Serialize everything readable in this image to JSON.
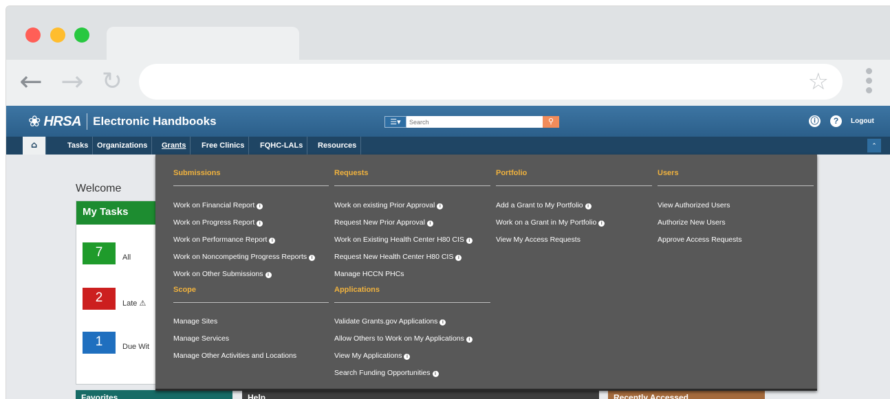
{
  "header": {
    "brand": "HRSA",
    "app_title": "Electronic Handbooks",
    "search_placeholder": "Search",
    "logout_label": "Logout"
  },
  "nav": {
    "items": [
      "Tasks",
      "Organizations",
      "Grants",
      "Free Clinics",
      "FQHC-LALs",
      "Resources"
    ],
    "active": "Grants"
  },
  "page": {
    "welcome": "Welcome",
    "my_tasks_title": "My Tasks",
    "tasks": [
      {
        "count": "7",
        "label": "All",
        "color": "#1f9b2b"
      },
      {
        "count": "2",
        "label": "Late",
        "color": "#cc1f1f"
      },
      {
        "count": "1",
        "label": "Due Wit",
        "color": "#1f6fbf"
      }
    ],
    "bottom_panels": [
      "Favorites",
      "Help",
      "Recently Accessed"
    ]
  },
  "mega_menu": {
    "submissions": {
      "heading": "Submissions",
      "links": [
        "Work on Financial Report",
        "Work on Progress Report",
        "Work on Performance Report",
        "Work on Noncompeting Progress Reports",
        "Work on Other Submissions"
      ]
    },
    "scope": {
      "heading": "Scope",
      "links": [
        "Manage Sites",
        "Manage Services",
        "Manage Other Activities and Locations"
      ]
    },
    "requests": {
      "heading": "Requests",
      "links": [
        "Work on existing Prior Approval",
        "Request New Prior Approval",
        "Work on Existing Health Center H80 CIS",
        "Request New Health Center H80 CIS",
        "Manage HCCN PHCs"
      ]
    },
    "applications": {
      "heading": "Applications",
      "links": [
        "Validate Grants.gov Applications",
        "Allow Others to Work on My Applications",
        "View My Applications",
        "Search Funding Opportunities"
      ]
    },
    "portfolio": {
      "heading": "Portfolio",
      "links": [
        "Add a Grant to My Portfolio",
        "Work on a Grant in My Portfolio",
        "View My Access Requests"
      ]
    },
    "users": {
      "heading": "Users",
      "links": [
        "View Authorized Users",
        "Authorize New Users",
        "Approve Access Requests"
      ]
    }
  },
  "colors": {
    "header_blue": "#2f6a97",
    "nav_dark": "#1f4564",
    "menu_gray": "#585858",
    "menu_heading": "#f0b23e",
    "tasks_green": "#1d8c30"
  }
}
